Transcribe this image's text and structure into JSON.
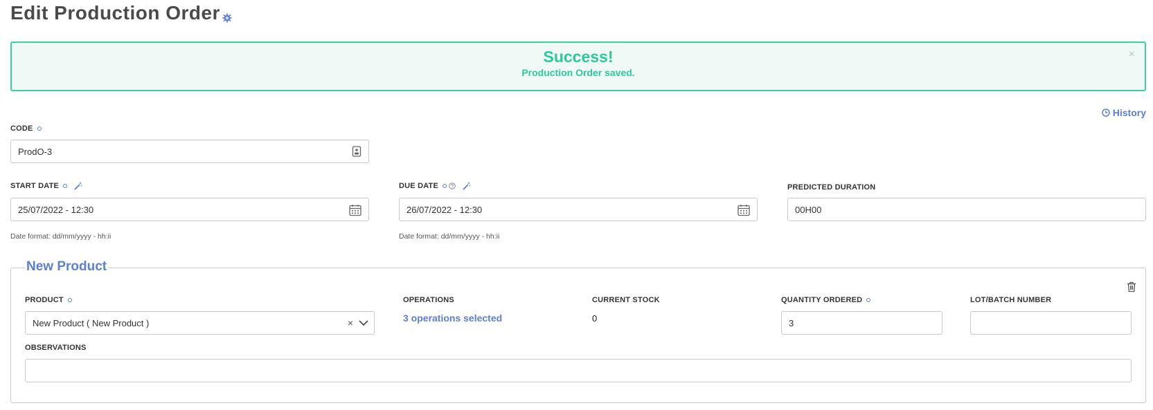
{
  "page": {
    "title": "Edit Production Order"
  },
  "alert": {
    "title": "Success!",
    "message": "Production Order saved.",
    "close": "×"
  },
  "history": {
    "label": "History"
  },
  "code": {
    "label": "CODE",
    "value": "ProdO-3"
  },
  "start_date": {
    "label": "START DATE",
    "value": "25/07/2022 - 12:30",
    "hint": "Date format: dd/mm/yyyy - hh:ii"
  },
  "due_date": {
    "label": "DUE DATE",
    "value": "26/07/2022 - 12:30",
    "hint": "Date format: dd/mm/yyyy - hh:ii"
  },
  "predicted_duration": {
    "label": "PREDICTED DURATION",
    "value": "00H00"
  },
  "product_section": {
    "legend": "New Product",
    "product": {
      "label": "PRODUCT",
      "value": "New Product ( New Product )",
      "clear": "×"
    },
    "operations": {
      "label": "OPERATIONS",
      "value": "3 operations selected"
    },
    "current_stock": {
      "label": "CURRENT STOCK",
      "value": "0"
    },
    "quantity_ordered": {
      "label": "QUANTITY ORDERED",
      "value": "3"
    },
    "lot_batch": {
      "label": "LOT/BATCH NUMBER",
      "value": ""
    },
    "observations": {
      "label": "OBSERVATIONS",
      "value": ""
    }
  },
  "colors": {
    "accent": "#5b7fd6",
    "success": "#2ec79d",
    "success_bg": "#effaf6",
    "border": "#c9c9c9"
  }
}
